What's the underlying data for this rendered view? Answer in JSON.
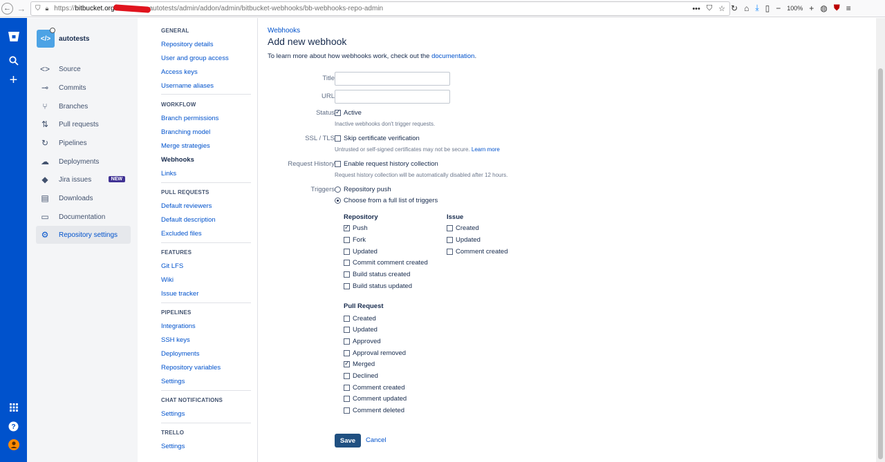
{
  "browser": {
    "url_prefix": "https://",
    "url_host": "bitbucket.org",
    "url_path": "autotests/admin/addon/admin/bitbucket-webhooks/bb-webhooks-repo-admin",
    "url_more": "•••",
    "zoom": "100%"
  },
  "global_nav": {
    "icons": [
      "bitbucket-logo-icon",
      "search-icon",
      "plus-icon",
      "apps-icon",
      "help-icon",
      "profile-icon"
    ]
  },
  "repo": {
    "avatar_text": "</>",
    "name": "autotests"
  },
  "sidebar": {
    "items": [
      {
        "label": "Source",
        "icon": "<>"
      },
      {
        "label": "Commits",
        "icon": "⊸"
      },
      {
        "label": "Branches",
        "icon": "⑂"
      },
      {
        "label": "Pull requests",
        "icon": "⇅"
      },
      {
        "label": "Pipelines",
        "icon": "↻"
      },
      {
        "label": "Deployments",
        "icon": "☁"
      },
      {
        "label": "Jira issues",
        "icon": "◆",
        "badge": "NEW"
      },
      {
        "label": "Downloads",
        "icon": "▤"
      },
      {
        "label": "Documentation",
        "icon": "▭"
      },
      {
        "label": "Repository settings",
        "icon": "⚙"
      }
    ]
  },
  "settings_nav": {
    "general": {
      "heading": "GENERAL",
      "links": [
        "Repository details",
        "User and group access",
        "Access keys",
        "Username aliases"
      ]
    },
    "workflow": {
      "heading": "WORKFLOW",
      "links": [
        "Branch permissions",
        "Branching model",
        "Merge strategies",
        "Webhooks",
        "Links"
      ]
    },
    "pull_requests": {
      "heading": "PULL REQUESTS",
      "links": [
        "Default reviewers",
        "Default description",
        "Excluded files"
      ]
    },
    "features": {
      "heading": "FEATURES",
      "links": [
        "Git LFS",
        "Wiki",
        "Issue tracker"
      ]
    },
    "pipelines": {
      "heading": "PIPELINES",
      "links": [
        "Integrations",
        "SSH keys",
        "Deployments",
        "Repository variables",
        "Settings"
      ]
    },
    "chat": {
      "heading": "CHAT NOTIFICATIONS",
      "links": [
        "Settings"
      ]
    },
    "trello": {
      "heading": "TRELLO",
      "links": [
        "Settings"
      ]
    }
  },
  "main": {
    "breadcrumb": "Webhooks",
    "title": "Add new webhook",
    "intro_text": "To learn more about how webhooks work, check out the ",
    "intro_link": "documentation",
    "intro_end": ".",
    "form": {
      "title_label": "Title",
      "title_value": "",
      "url_label": "URL",
      "url_value": "",
      "status_label": "Status",
      "status_option": "Active",
      "status_checked": true,
      "status_help": "Inactive webhooks don't trigger requests.",
      "ssl_label": "SSL / TLS",
      "ssl_option": "Skip certificate verification",
      "ssl_checked": false,
      "ssl_help": "Untrusted or self-signed certificates may not be secure.",
      "ssl_help_link": "Learn more",
      "history_label": "Request History",
      "history_option": "Enable request history collection",
      "history_checked": false,
      "history_help": "Request history collection will be automatically disabled after 12 hours.",
      "triggers_label": "Triggers",
      "trigger_push": "Repository push",
      "trigger_full": "Choose from a full list of triggers",
      "trigger_selected": "full",
      "repository_heading": "Repository",
      "repository_triggers": [
        {
          "label": "Push",
          "checked": true
        },
        {
          "label": "Fork",
          "checked": false
        },
        {
          "label": "Updated",
          "checked": false
        },
        {
          "label": "Commit comment created",
          "checked": false
        },
        {
          "label": "Build status created",
          "checked": false
        },
        {
          "label": "Build status updated",
          "checked": false
        }
      ],
      "issue_heading": "Issue",
      "issue_triggers": [
        {
          "label": "Created",
          "checked": false
        },
        {
          "label": "Updated",
          "checked": false
        },
        {
          "label": "Comment created",
          "checked": false
        }
      ],
      "pr_heading": "Pull Request",
      "pr_triggers": [
        {
          "label": "Created",
          "checked": false
        },
        {
          "label": "Updated",
          "checked": false
        },
        {
          "label": "Approved",
          "checked": false
        },
        {
          "label": "Approval removed",
          "checked": false
        },
        {
          "label": "Merged",
          "checked": true
        },
        {
          "label": "Declined",
          "checked": false
        },
        {
          "label": "Comment created",
          "checked": false
        },
        {
          "label": "Comment updated",
          "checked": false
        },
        {
          "label": "Comment deleted",
          "checked": false
        }
      ],
      "save_label": "Save",
      "cancel_label": "Cancel"
    }
  },
  "colors": {
    "brand": "#0052cc",
    "save_button": "#205081",
    "new_badge": "#403294"
  }
}
